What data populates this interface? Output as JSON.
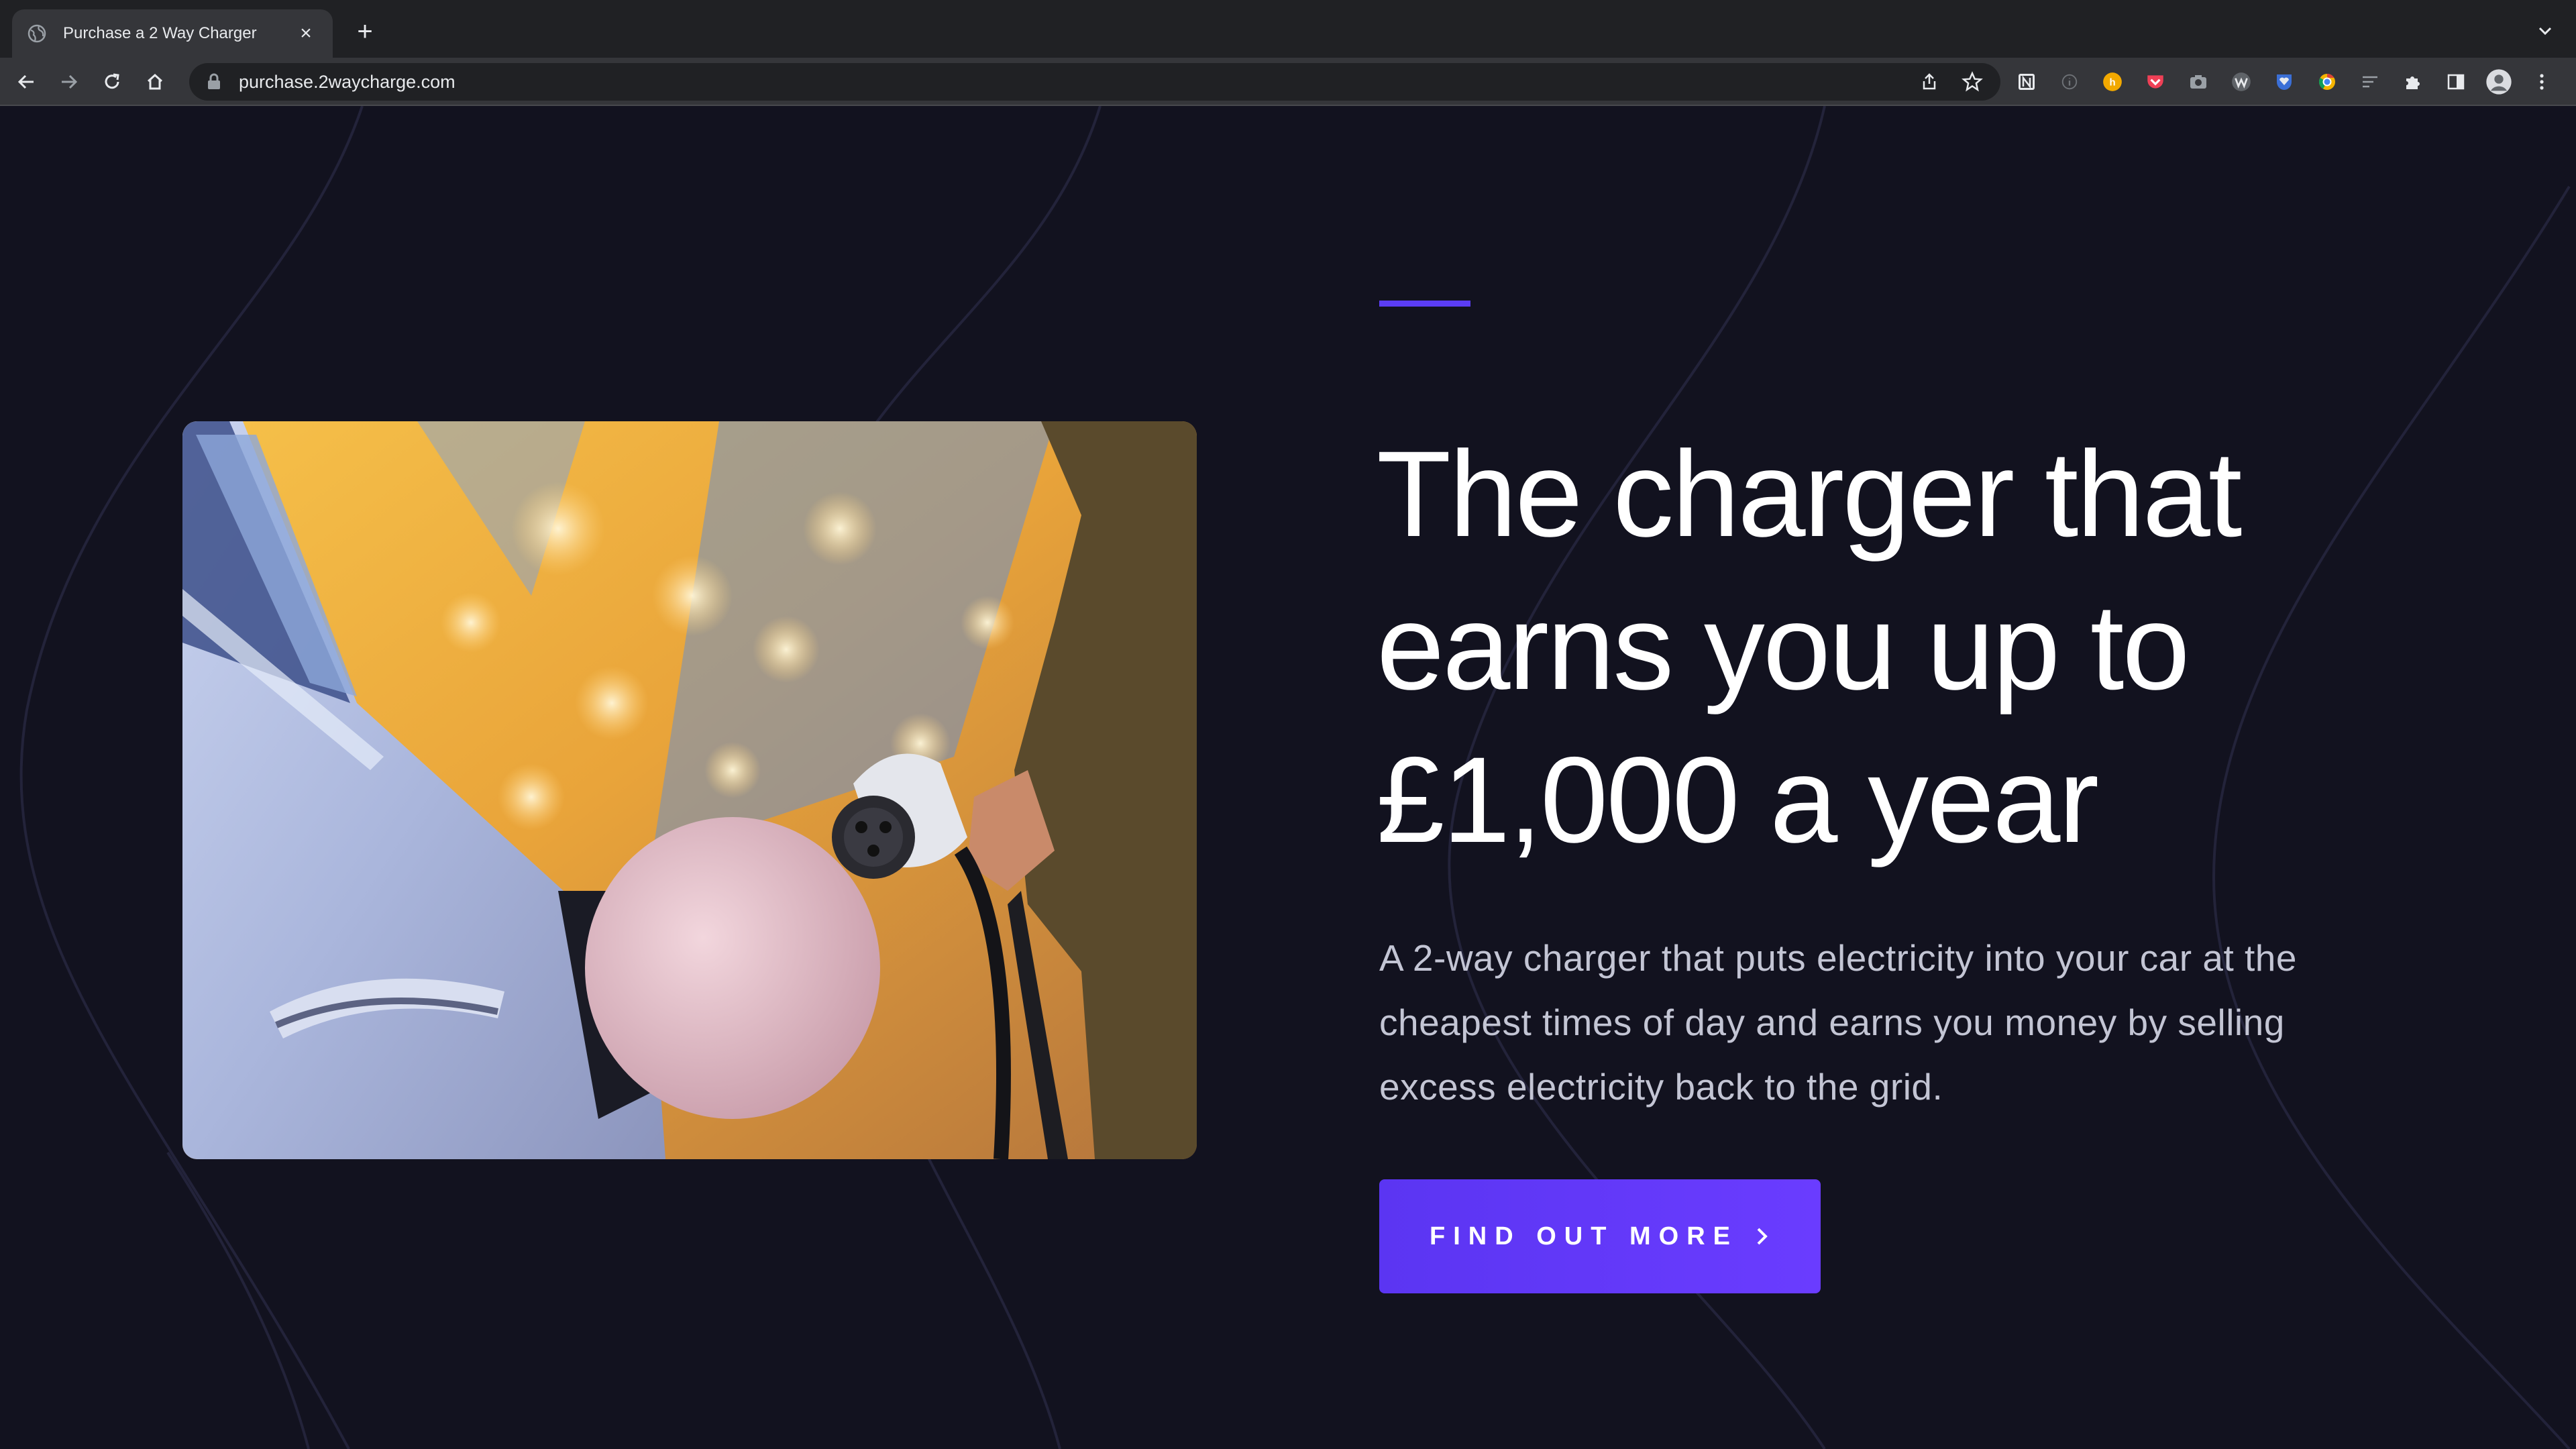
{
  "browser": {
    "tab": {
      "title": "Purchase a 2 Way Charger",
      "close_icon": "×",
      "favicon": "globe-icon"
    },
    "new_tab_icon": "+",
    "address_bar": {
      "url": "purchase.2waycharge.com"
    },
    "nav_icons": [
      "back-arrow-icon",
      "forward-arrow-icon",
      "reload-icon",
      "home-icon"
    ],
    "omnibox_icons": [
      "share-icon",
      "bookmark-star-icon"
    ],
    "extension_icons": [
      "notion-icon",
      "info-icon",
      "honey-icon",
      "pocket-icon",
      "camera-icon",
      "wordtune-icon",
      "bitwarden-icon",
      "chrome-color-icon",
      "reading-list-icon",
      "puzzle-extensions-icon",
      "side-panel-icon",
      "profile-avatar-icon",
      "kebab-menu-icon"
    ]
  },
  "hero": {
    "headline_line1": "The charger that",
    "headline_line2": "earns you up to",
    "headline_line3": "£1,000 a year",
    "description_line1": "A 2-way charger that puts electricity into your car at the",
    "description_line2": "cheapest times of day and earns you money by selling",
    "description_line3": "excess electricity back to the grid.",
    "cta_label": "FIND OUT MORE",
    "image_subject": "person plugging a charger into an electric car"
  },
  "colors": {
    "page_background": "#12121f",
    "accent": "#5b3df5",
    "button": "#6a3cff",
    "headline_text": "#ffffff",
    "body_text": "#c3c5d4"
  }
}
